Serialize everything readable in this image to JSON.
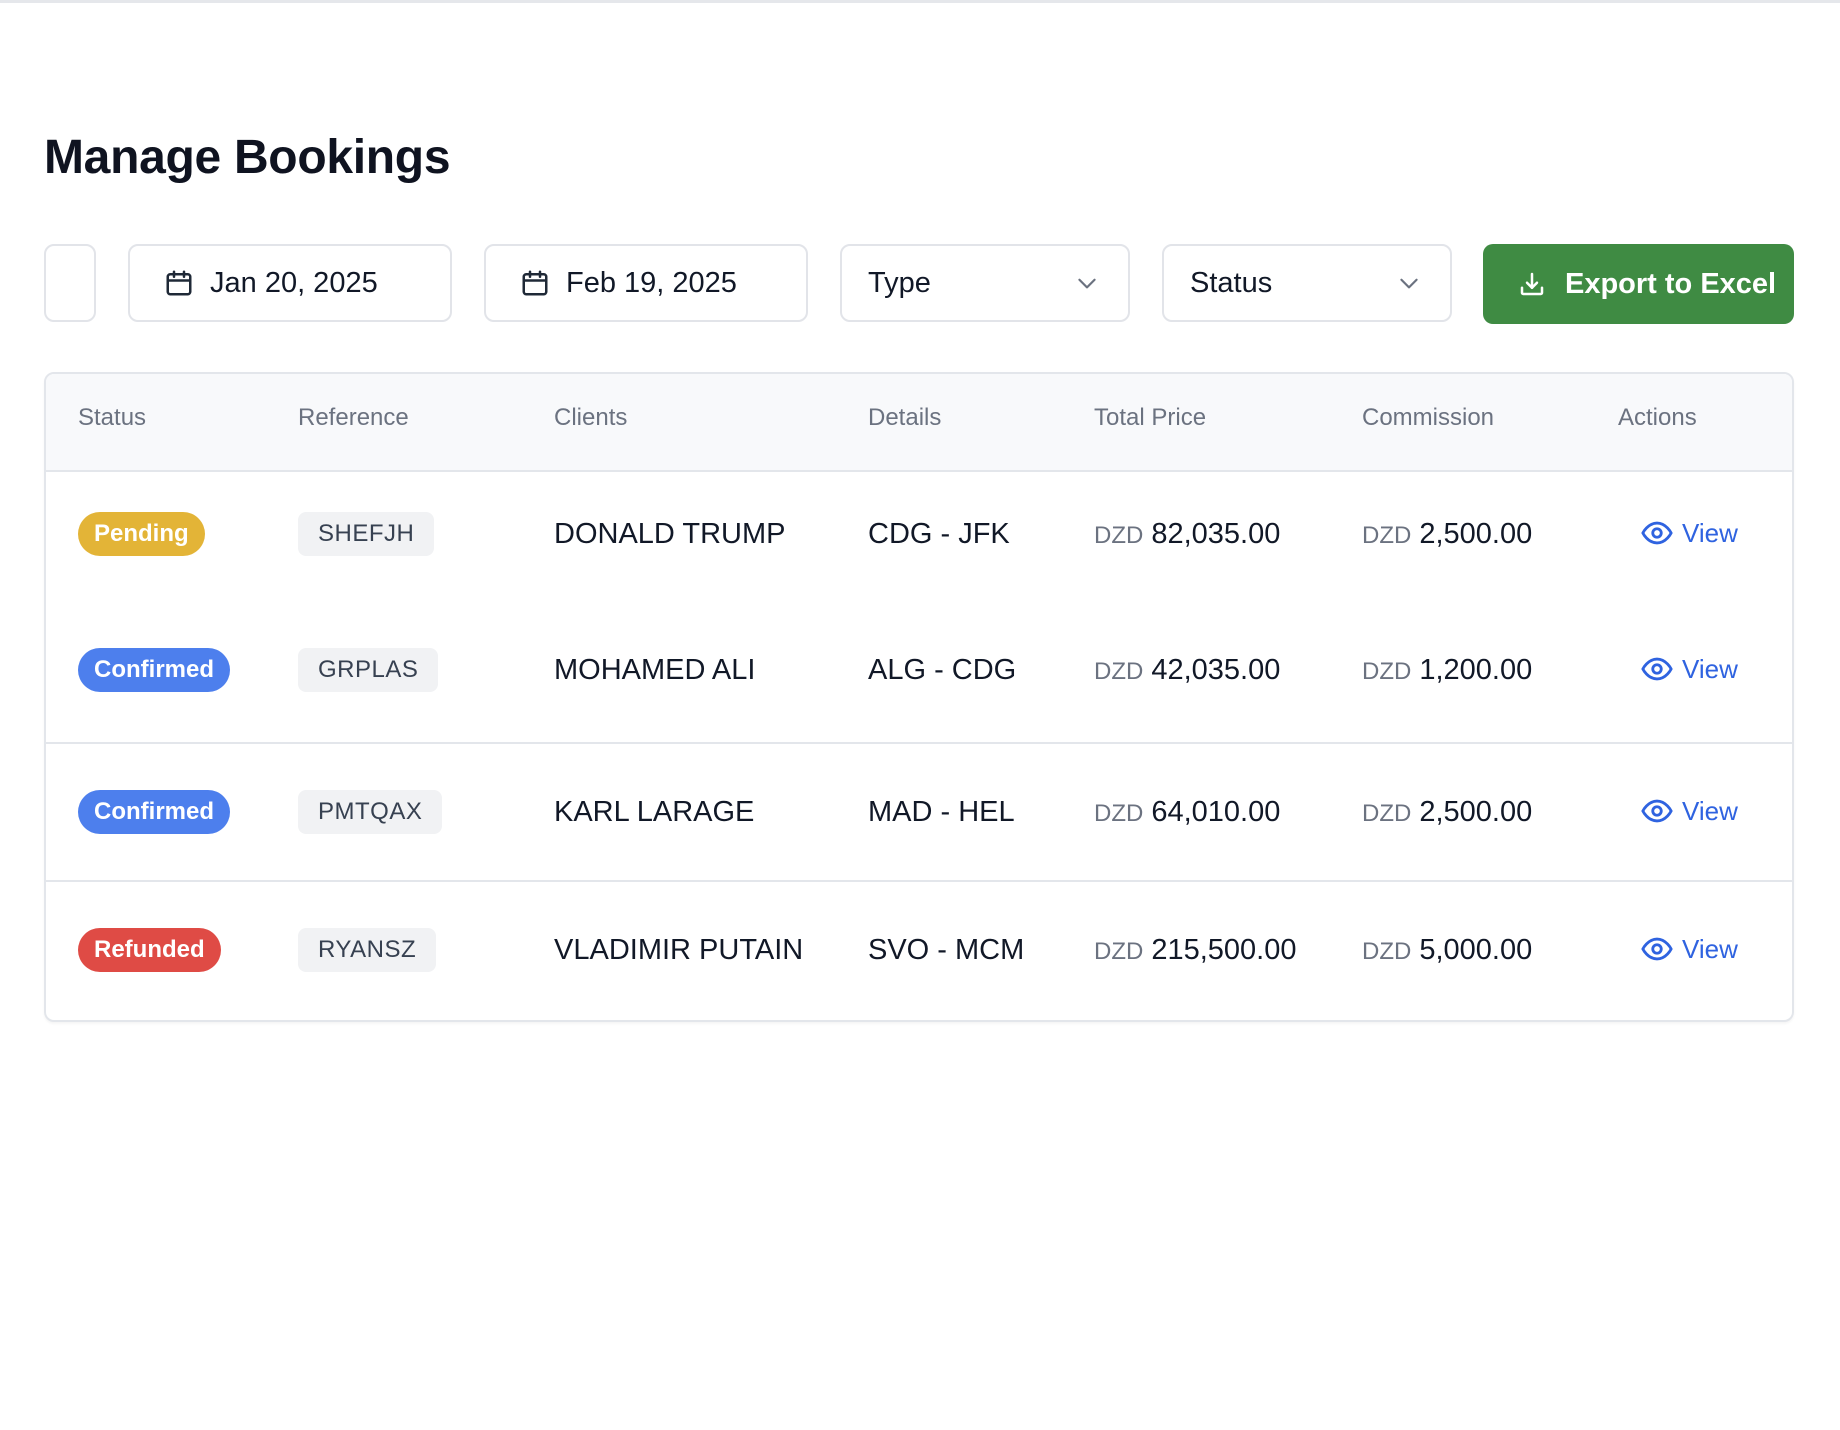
{
  "page": {
    "title": "Manage Bookings"
  },
  "filters": {
    "date_from": "Jan 20, 2025",
    "date_to": "Feb 19, 2025",
    "type_label": "Type",
    "status_label": "Status",
    "export_label": "Export to Excel"
  },
  "colors": {
    "export": "#3f8b43",
    "pending": "#e3b437",
    "confirmed": "#4d7fed",
    "refunded": "#df4b45",
    "link": "#2f63e0"
  },
  "icons": {
    "date": "calendar-icon",
    "select": "chevron-down-icon",
    "export": "download-icon",
    "view": "eye-icon"
  },
  "table": {
    "columns": [
      "Status",
      "Reference",
      "Clients",
      "Details",
      "Total Price",
      "Commission",
      "Actions"
    ],
    "rows": [
      {
        "status": "Pending",
        "status_color": "#e3b437",
        "reference": "SHEFJH",
        "client": "DONALD TRUMP",
        "details": "CDG - JFK",
        "price_currency": "DZD",
        "price": "82,035.00",
        "commission_currency": "DZD",
        "commission": "2,500.00",
        "action": "View"
      },
      {
        "status": "Confirmed",
        "status_color": "#4d7fed",
        "reference": "GRPLAS",
        "client": "MOHAMED ALI",
        "details": "ALG - CDG",
        "price_currency": "DZD",
        "price": "42,035.00",
        "commission_currency": "DZD",
        "commission": "1,200.00",
        "action": "View"
      },
      {
        "status": "Confirmed",
        "status_color": "#4d7fed",
        "reference": "PMTQAX",
        "client": "KARL LARAGE",
        "details": "MAD - HEL",
        "price_currency": "DZD",
        "price": "64,010.00",
        "commission_currency": "DZD",
        "commission": "2,500.00",
        "action": "View"
      },
      {
        "status": "Refunded",
        "status_color": "#df4b45",
        "reference": "RYANSZ",
        "client": "VLADIMIR PUTAIN",
        "details": "SVO - MCM",
        "price_currency": "DZD",
        "price": "215,500.00",
        "commission_currency": "DZD",
        "commission": "5,000.00",
        "action": "View"
      }
    ]
  }
}
